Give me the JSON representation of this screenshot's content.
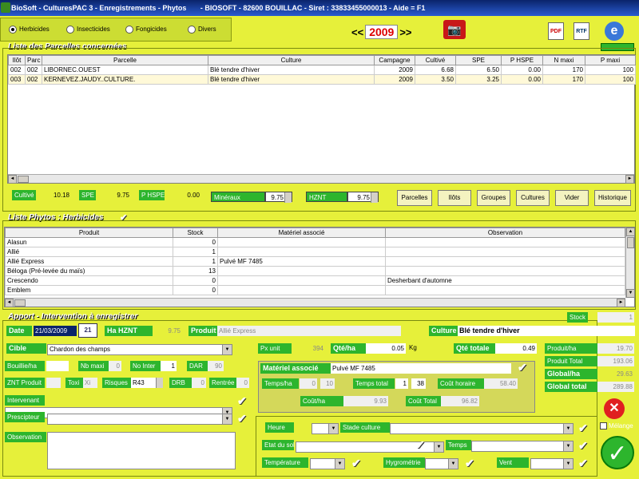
{
  "window": {
    "title": "BioSoft - CulturesPAC 3 - Enregistrements - Phytos       - BIOSOFT - 82600 BOUILLAC - Siret : 33833455000013 - Aide = F1"
  },
  "filters": [
    {
      "label": "Herbicides",
      "selected": true
    },
    {
      "label": "Insecticides",
      "selected": false
    },
    {
      "label": "Fongicides",
      "selected": false
    },
    {
      "label": "Divers",
      "selected": false
    }
  ],
  "year": {
    "prev": "<<",
    "value": "2009",
    "next": ">>"
  },
  "toolbar": {
    "pdf": "PDF",
    "rtf": "RTF",
    "ie": "e"
  },
  "parcelles": {
    "title": "Liste des Parcelles concernées",
    "columns": [
      "Ilôt",
      "Parc",
      "Parcelle",
      "Culture",
      "Campagne",
      "Cultivé",
      "SPE",
      "P HSPE",
      "N maxi",
      "P maxi"
    ],
    "rows": [
      [
        "002",
        "002",
        "LIBORNEC.OUEST",
        "Blé tendre d'hiver",
        "2009",
        "6.68",
        "6.50",
        "0.00",
        "170",
        "100"
      ],
      [
        "003",
        "002",
        "KERNEVEZ.JAUDY..CULTURE.",
        "Blé tendre d'hiver",
        "2009",
        "3.50",
        "3.25",
        "0.00",
        "170",
        "100"
      ]
    ],
    "totals": {
      "cultive_label": "Cultivé",
      "cultive": "10.18",
      "spe_label": "SPE",
      "spe": "9.75",
      "phspe_label": "P HSPE",
      "phspe": "0.00",
      "mineraux_label": "Minéraux",
      "mineraux": "9.75",
      "hznt_label": "HZNT",
      "hznt": "9.75"
    },
    "buttons": [
      "Parcelles",
      "Ilôts",
      "Groupes",
      "Cultures",
      "Vider",
      "Historique"
    ]
  },
  "phytos": {
    "title": "Liste Phytos : Herbicides",
    "columns": [
      "Produit",
      "Stock",
      "Matériel associé",
      "Observation"
    ],
    "rows": [
      [
        "Alasun",
        "0",
        "",
        ""
      ],
      [
        "Allié",
        "1",
        "",
        ""
      ],
      [
        "Allié Express",
        "1",
        "Pulvé MF 7485",
        ""
      ],
      [
        "Béloga (Pré-levée du maïs)",
        "13",
        "",
        ""
      ],
      [
        "Crescendo",
        "0",
        "",
        "Desherbant d'automne"
      ],
      [
        "Emblem",
        "0",
        "",
        ""
      ]
    ]
  },
  "apport": {
    "title": "Apport - Intervention à enregistrer",
    "stock_label": "Stock",
    "stock": "1",
    "date_label": "Date",
    "date": "21/03/2009",
    "cal_icon": "21",
    "hznt_label": "Ha HZNT",
    "hznt": "9.75",
    "produit_label": "Produit",
    "produit": "Allié Express",
    "culture_label": "Culture",
    "culture": "Blé tendre d'hiver",
    "cible_label": "Cible",
    "cible": "Chardon des champs",
    "px_unit_label": "Px unit",
    "px_unit": "394",
    "qte_ha_label": "Qté/ha",
    "qte_ha": "0.05",
    "unit": "Kg",
    "qte_totale_label": "Qté totale",
    "qte_totale": "0.49",
    "bouillie_label": "Bouillie/ha",
    "bouillie": "",
    "nbmaxi_label": "Nb maxi",
    "nbmaxi": "0",
    "nointer_label": "No Inter",
    "nointer": "1",
    "dar_label": "DAR",
    "dar": "90",
    "znt_label": "ZNT Produit",
    "znt": "",
    "toxi_label": "Toxi",
    "toxi": "Xi",
    "risques_label": "Risques",
    "risques": "R43",
    "drb_label": "DRB",
    "drb": "0",
    "rentree_label": "Rentrée",
    "rentree": "0",
    "intervenant_label": "Intervenant",
    "intervenant": "",
    "prescripteur_label": "Prescipteur",
    "prescripteur": "",
    "observation_label": "Observation",
    "observation": "",
    "materiel": {
      "label": "Matériel associé",
      "value": "Pulvé MF 7485",
      "temps_ha_label": "Temps/ha",
      "temps_ha_1": "0",
      "temps_ha_2": "10",
      "temps_total_label": "Temps total",
      "temps_total_1": "1",
      "temps_total_2": "38",
      "cout_horaire_label": "Coût horaire",
      "cout_horaire": "58.40",
      "cout_ha_label": "Coût/ha",
      "cout_ha": "9.93",
      "cout_total_label": "Coût Total",
      "cout_total": "96.82"
    },
    "produit_ha_label": "Produit/ha",
    "produit_ha": "19.70",
    "produit_total_label": "Produit Total",
    "produit_total": "193.06",
    "global_ha_label": "Global/ha",
    "global_ha": "29.63",
    "global_total_label": "Global total",
    "global_total": "289.88",
    "heure_label": "Heure",
    "heure": "",
    "stade_label": "Stade culture",
    "stade": "",
    "etat_sol_label": "Etat du sol",
    "etat_sol": "",
    "temps_label": "Temps",
    "temps": "",
    "temperature_label": "Température",
    "temperature": "",
    "hygrometrie_label": "Hygrométrie",
    "hygrometrie": "",
    "vent_label": "Vent",
    "vent": "",
    "melange_label": "Mélange"
  },
  "icons": {
    "check": "✔",
    "close": "✕",
    "ok": "✓",
    "camera": "📷",
    "dropdown": "▼",
    "scroll_left": "◄",
    "scroll_right": "►",
    "scroll_up": "▲",
    "scroll_down": "▼"
  }
}
